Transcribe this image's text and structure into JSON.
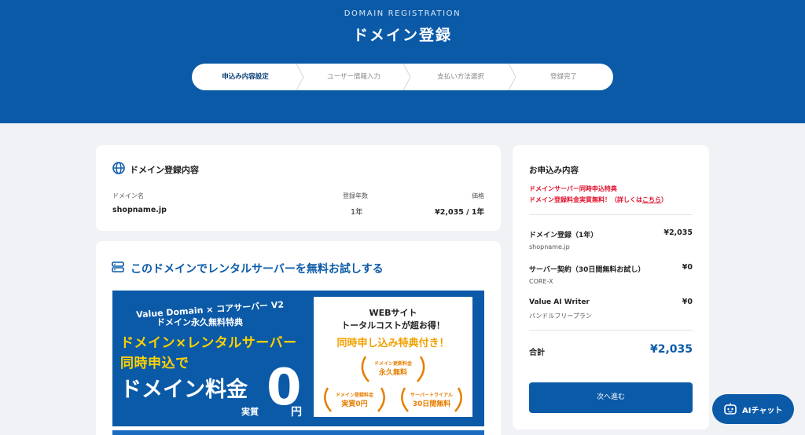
{
  "header": {
    "subtitle": "DOMAIN REGISTRATION",
    "title": "ドメイン登録"
  },
  "steps": [
    {
      "label": "申込み内容設定",
      "active": true
    },
    {
      "label": "ユーザー情報入力",
      "active": false
    },
    {
      "label": "支払い方法選択",
      "active": false
    },
    {
      "label": "登録完了",
      "active": false
    }
  ],
  "domain_card": {
    "title": "ドメイン登録内容",
    "icon": "globe-icon",
    "col_domain": "ドメイン名",
    "col_years": "登録年数",
    "col_price": "価格",
    "domain": "shopname.jp",
    "years": "1年",
    "price": "¥2,035 / 1年"
  },
  "promo": {
    "title": "このドメインでレンタルサーバーを無料お試しする",
    "icon": "server-icon",
    "banner": {
      "brand": "Value Domain × コアサーバー V2",
      "line2": "ドメイン永久無料特典",
      "line3": "ドメイン×レンタルサーバー",
      "line4": "同時申込で",
      "big": "ドメイン料金",
      "zero": "0",
      "jishitsu": "実質",
      "yen": "円",
      "panel_line1": "WEBサイト",
      "panel_line2": "トータルコストが超お得！",
      "panel_line3": "同時申し込み特典付き！",
      "award1_small": "ドメイン更新料金",
      "award1_main": "永久無料",
      "award2_small": "ドメイン登録料金",
      "award2_main": "実質0円",
      "award3_small": "サーバートライアル",
      "award3_main": "30日間無料"
    }
  },
  "order": {
    "title": "お申込み内容",
    "notice_line1": "ドメインサーバー同時申込特典",
    "notice_line2": "ドメイン登録料金実質無料！（詳しくは",
    "notice_link": "こちら",
    "notice_close": "）",
    "items": [
      {
        "name": "ドメイン登録（1年）",
        "price": "¥2,035",
        "sub": "shopname.jp"
      },
      {
        "name": "サーバー契約（30日間無料お試し）",
        "price": "¥0",
        "sub": "CORE-X"
      },
      {
        "name": "Value AI Writer",
        "price": "¥0",
        "sub": "バンドルフリープラン"
      }
    ],
    "total_label": "合計",
    "total_price": "¥2,035",
    "next_label": "次へ進む"
  },
  "chat": {
    "label": "AIチャット",
    "icon": "robot-icon"
  },
  "colors": {
    "brand": "#0b5aa8",
    "accent_yellow": "#ffd200",
    "notice_red": "#e0102b"
  }
}
